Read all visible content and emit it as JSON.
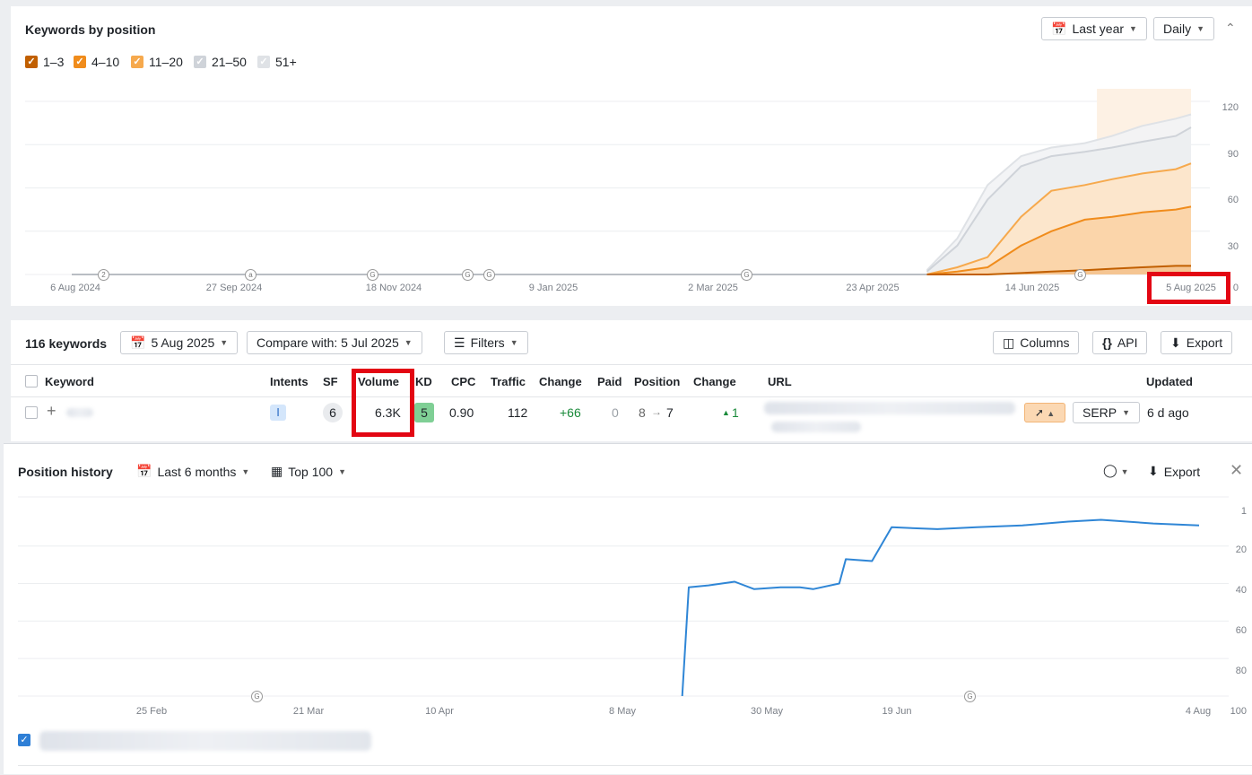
{
  "top_chart": {
    "title": "Keywords by position",
    "range_label": "Last year",
    "granularity_label": "Daily",
    "legend": [
      {
        "label": "1–3",
        "color": "#c15f00"
      },
      {
        "label": "4–10",
        "color": "#f08c1c"
      },
      {
        "label": "11–20",
        "color": "#f6a94d"
      },
      {
        "label": "21–50",
        "color": "#cfd3d9"
      },
      {
        "label": "51+",
        "color": "#dfe2e6"
      }
    ],
    "x_ticks": [
      "6 Aug 2024",
      "27 Sep 2024",
      "18 Nov 2024",
      "9 Jan 2025",
      "2 Mar 2025",
      "23 Apr 2025",
      "14 Jun 2025",
      "5 Aug 2025"
    ],
    "y_ticks": [
      "120",
      "90",
      "60",
      "30",
      "0"
    ]
  },
  "chart_data": [
    {
      "type": "area",
      "x": [
        "2025-05-10",
        "2025-05-20",
        "2025-05-30",
        "2025-06-10",
        "2025-06-20",
        "2025-07-01",
        "2025-07-10",
        "2025-07-20",
        "2025-07-31",
        "2025-08-05"
      ],
      "series": [
        {
          "name": "1–3",
          "values": [
            0,
            0,
            0,
            1,
            2,
            3,
            4,
            5,
            6,
            6
          ]
        },
        {
          "name": "4–10",
          "values": [
            0,
            2,
            5,
            20,
            30,
            38,
            40,
            43,
            45,
            47
          ]
        },
        {
          "name": "11–20",
          "values": [
            0,
            5,
            12,
            40,
            58,
            62,
            66,
            70,
            73,
            77
          ]
        },
        {
          "name": "21–50",
          "values": [
            2,
            20,
            52,
            75,
            82,
            85,
            88,
            92,
            96,
            102
          ]
        },
        {
          "name": "51+",
          "values": [
            3,
            25,
            62,
            82,
            88,
            91,
            96,
            103,
            108,
            111
          ]
        }
      ],
      "ylim": [
        0,
        120
      ],
      "legend": "top-left",
      "grid": true
    },
    {
      "type": "line",
      "x": [
        "2025-05-17",
        "2025-05-18",
        "2025-05-21",
        "2025-05-25",
        "2025-05-28",
        "2025-06-01",
        "2025-06-04",
        "2025-06-06",
        "2025-06-10",
        "2025-06-11",
        "2025-06-15",
        "2025-06-18",
        "2025-06-25",
        "2025-07-01",
        "2025-07-08",
        "2025-07-15",
        "2025-07-20",
        "2025-07-28",
        "2025-08-04"
      ],
      "series": [
        {
          "name": "",
          "values": [
            100,
            42,
            41,
            39,
            43,
            42,
            42,
            43,
            40,
            27,
            28,
            10,
            11,
            10,
            9,
            7,
            6,
            8,
            9
          ]
        }
      ],
      "ylim": [
        1,
        100
      ],
      "y_inverted": true,
      "grid": true
    }
  ],
  "toolbar": {
    "count": "116 keywords",
    "date": "5 Aug 2025",
    "compare": "Compare with: 5 Jul 2025",
    "filters": "Filters",
    "columns": "Columns",
    "api": "API",
    "export": "Export"
  },
  "table": {
    "headers": {
      "keyword": "Keyword",
      "intents": "Intents",
      "sf": "SF",
      "volume": "Volume",
      "kd": "KD",
      "cpc": "CPC",
      "traffic": "Traffic",
      "change": "Change",
      "paid": "Paid",
      "position": "Position",
      "change2": "Change",
      "url": "URL",
      "updated": "Updated"
    },
    "row": {
      "intent": "I",
      "sf": "6",
      "volume": "6.3K",
      "kd": "5",
      "cpc": "0.90",
      "traffic": "112",
      "change": "+66",
      "paid": "0",
      "pos_from": "8",
      "pos_to": "7",
      "pos_change": "1",
      "serp": "SERP",
      "updated": "6 d ago"
    }
  },
  "history": {
    "title": "Position history",
    "range": "Last 6 months",
    "top": "Top 100",
    "export": "Export",
    "x_ticks": [
      "25 Feb",
      "21 Mar",
      "10 Apr",
      "8 May",
      "30 May",
      "19 Jun",
      "4 Aug"
    ],
    "y_ticks": [
      "1",
      "20",
      "40",
      "60",
      "80",
      "100"
    ]
  }
}
